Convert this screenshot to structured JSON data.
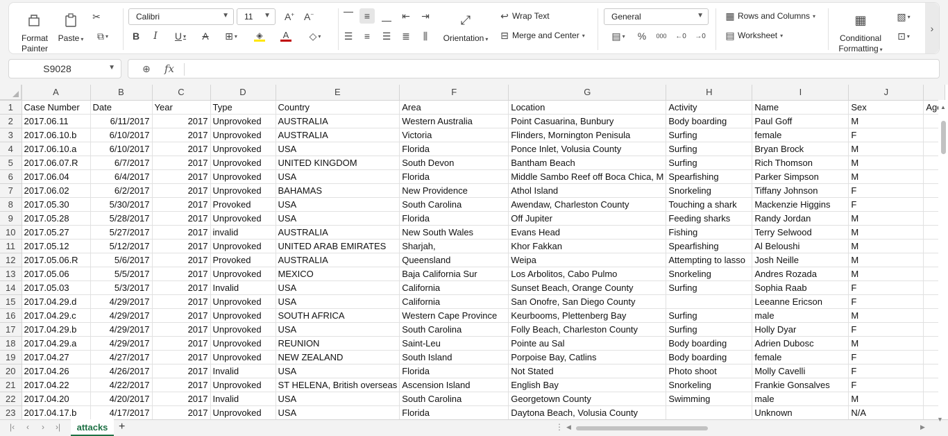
{
  "ribbon": {
    "format_painter": [
      "Format",
      "Painter"
    ],
    "paste": "Paste",
    "font_name": "Calibri",
    "font_size": "11",
    "wrap_text": "Wrap Text",
    "merge_center": "Merge and Center",
    "orientation": "Orientation",
    "number_format": "General",
    "rows_columns": "Rows and Columns",
    "worksheet": "Worksheet",
    "conditional_formatting": [
      "Conditional",
      "Formatting"
    ],
    "percent": "%",
    "thousands": "000",
    "font_color": "#c00000",
    "highlight_color": "#ffe600"
  },
  "formula_bar": {
    "name_box": "S9028",
    "fx": "fx",
    "formula": ""
  },
  "columns": [
    "A",
    "B",
    "C",
    "D",
    "E",
    "F",
    "G",
    "H",
    "I",
    "J",
    ""
  ],
  "rows": [
    {
      "n": "1",
      "c": [
        "Case Number",
        "Date",
        "Year",
        "Type",
        "Country",
        "Area",
        "Location",
        "Activity",
        "Name",
        "Sex",
        "Age"
      ]
    },
    {
      "n": "2",
      "c": [
        "2017.06.11",
        "6/11/2017",
        "2017",
        "Unprovoked",
        "AUSTRALIA",
        "Western Australia",
        "Point Casuarina, Bunbury",
        "Body boarding",
        "Paul Goff",
        "M",
        ""
      ]
    },
    {
      "n": "3",
      "c": [
        "2017.06.10.b",
        "6/10/2017",
        "2017",
        "Unprovoked",
        "AUSTRALIA",
        "Victoria",
        "Flinders, Mornington Penisula",
        "Surfing",
        "female",
        "F",
        ""
      ]
    },
    {
      "n": "4",
      "c": [
        "2017.06.10.a",
        "6/10/2017",
        "2017",
        "Unprovoked",
        "USA",
        "Florida",
        "Ponce Inlet, Volusia County",
        "Surfing",
        "Bryan Brock",
        "M",
        ""
      ]
    },
    {
      "n": "5",
      "c": [
        "2017.06.07.R",
        "6/7/2017",
        "2017",
        "Unprovoked",
        "UNITED KINGDOM",
        "South Devon",
        "Bantham Beach",
        "Surfing",
        "Rich Thomson",
        "M",
        ""
      ]
    },
    {
      "n": "6",
      "c": [
        "2017.06.04",
        "6/4/2017",
        "2017",
        "Unprovoked",
        "USA",
        "Florida",
        "Middle Sambo Reef off Boca Chica, M",
        "Spearfishing",
        "Parker Simpson",
        "M",
        ""
      ]
    },
    {
      "n": "7",
      "c": [
        "2017.06.02",
        "6/2/2017",
        "2017",
        "Unprovoked",
        "BAHAMAS",
        "New Providence",
        "Athol Island",
        "Snorkeling",
        "Tiffany Johnson",
        "F",
        ""
      ]
    },
    {
      "n": "8",
      "c": [
        "2017.05.30",
        "5/30/2017",
        "2017",
        "Provoked",
        "USA",
        "South Carolina",
        "Awendaw, Charleston County",
        "Touching a shark",
        "Mackenzie Higgins",
        "F",
        ""
      ]
    },
    {
      "n": "9",
      "c": [
        "2017.05.28",
        "5/28/2017",
        "2017",
        "Unprovoked",
        "USA",
        "Florida",
        "Off Jupiter",
        "Feeding sharks",
        "Randy Jordan",
        "M",
        ""
      ]
    },
    {
      "n": "10",
      "c": [
        "2017.05.27",
        "5/27/2017",
        "2017",
        "invalid",
        "AUSTRALIA",
        "New South Wales",
        "Evans Head",
        "Fishing",
        "Terry Selwood",
        "M",
        ""
      ]
    },
    {
      "n": "11",
      "c": [
        "2017.05.12",
        "5/12/2017",
        "2017",
        "Unprovoked",
        "UNITED ARAB EMIRATES",
        "Sharjah,",
        "Khor Fakkan",
        "Spearfishing",
        "Al Beloushi",
        "M",
        ""
      ]
    },
    {
      "n": "12",
      "c": [
        "2017.05.06.R",
        "5/6/2017",
        "2017",
        "Provoked",
        "AUSTRALIA",
        "Queensland",
        "Weipa",
        "Attempting to lasso",
        "Josh Neille",
        "M",
        ""
      ]
    },
    {
      "n": "13",
      "c": [
        "2017.05.06",
        "5/5/2017",
        "2017",
        "Unprovoked",
        "MEXICO",
        "Baja California Sur",
        "Los Arbolitos, Cabo Pulmo",
        "Snorkeling",
        "Andres Rozada",
        "M",
        ""
      ]
    },
    {
      "n": "14",
      "c": [
        "2017.05.03",
        "5/3/2017",
        "2017",
        "Invalid",
        "USA",
        "California",
        "Sunset Beach, Orange County",
        "Surfing",
        "Sophia Raab",
        "F",
        ""
      ]
    },
    {
      "n": "15",
      "c": [
        "2017.04.29.d",
        "4/29/2017",
        "2017",
        "Unprovoked",
        "USA",
        "California",
        "San Onofre, San Diego County",
        "",
        "Leeanne Ericson",
        "F",
        ""
      ]
    },
    {
      "n": "16",
      "c": [
        "2017.04.29.c",
        "4/29/2017",
        "2017",
        "Unprovoked",
        "SOUTH AFRICA",
        "Western Cape Province",
        "Keurbooms, Plettenberg Bay",
        "Surfing",
        "male",
        "M",
        ""
      ]
    },
    {
      "n": "17",
      "c": [
        "2017.04.29.b",
        "4/29/2017",
        "2017",
        "Unprovoked",
        "USA",
        "South Carolina",
        "Folly Beach, Charleston County",
        "Surfing",
        "Holly Dyar",
        "F",
        ""
      ]
    },
    {
      "n": "18",
      "c": [
        "2017.04.29.a",
        "4/29/2017",
        "2017",
        "Unprovoked",
        "REUNION",
        "Saint-Leu",
        "Pointe au Sal",
        "Body boarding",
        "Adrien Dubosc",
        "M",
        ""
      ]
    },
    {
      "n": "19",
      "c": [
        "2017.04.27",
        "4/27/2017",
        "2017",
        "Unprovoked",
        "NEW ZEALAND",
        "South Island",
        "Porpoise Bay, Catlins",
        "Body boarding",
        "female",
        "F",
        ""
      ]
    },
    {
      "n": "20",
      "c": [
        "2017.04.26",
        "4/26/2017",
        "2017",
        "Invalid",
        "USA",
        "Florida",
        "Not Stated",
        "Photo shoot",
        "Molly Cavelli",
        "F",
        ""
      ]
    },
    {
      "n": "21",
      "c": [
        "2017.04.22",
        "4/22/2017",
        "2017",
        "Unprovoked",
        "ST HELENA, British overseas",
        "Ascension Island",
        "English Bay",
        "Snorkeling",
        "Frankie Gonsalves",
        "F",
        ""
      ]
    },
    {
      "n": "22",
      "c": [
        "2017.04.20",
        "4/20/2017",
        "2017",
        "Invalid",
        "USA",
        "South Carolina",
        "Georgetown County",
        "Swimming",
        "male",
        "M",
        ""
      ]
    },
    {
      "n": "23",
      "c": [
        "2017.04.17.b",
        "4/17/2017",
        "2017",
        "Unprovoked",
        "USA",
        "Florida",
        "Daytona Beach, Volusia County",
        "",
        "Unknown",
        "N/A",
        ""
      ]
    }
  ],
  "sheet_tab": "attacks",
  "add_sheet": "+"
}
